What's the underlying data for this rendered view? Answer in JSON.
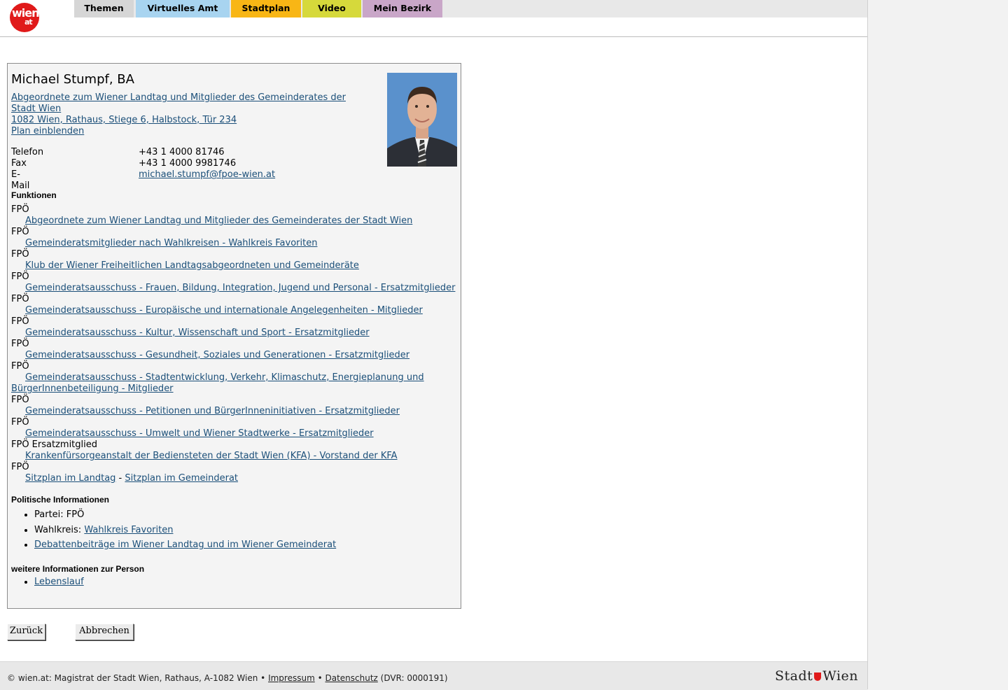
{
  "header": {
    "logo": {
      "line1": "wien",
      "line2": "at"
    },
    "tabs": [
      {
        "label": "Themen",
        "color": "#d6d6d6"
      },
      {
        "label": "Virtuelles Amt",
        "color": "#a8d4f0"
      },
      {
        "label": "Stadtplan",
        "color": "#f8b615"
      },
      {
        "label": "Video",
        "color": "#d6d93b"
      },
      {
        "label": "Mein Bezirk",
        "color": "#c9a6c8"
      }
    ]
  },
  "person": {
    "name": "Michael Stumpf, BA",
    "role_line1": "Abgeordnete zum Wiener Landtag und Mitglieder des Gemeinderates der",
    "role_line2": "Stadt Wien",
    "address": "1082 Wien, Rathaus, Stiege 6, Halbstock, Tür 234",
    "map_link": "Plan einblenden",
    "contact": {
      "phone_label": "Telefon",
      "phone": "+43 1 4000 81746",
      "fax_label": "Fax",
      "fax": "+43 1 4000 9981746",
      "email_label": "E-Mail",
      "email": "michael.stumpf@fpoe-wien.at"
    }
  },
  "functions": {
    "heading": "Funktionen",
    "items": [
      {
        "org": "FPÖ",
        "link": "Abgeordnete zum Wiener Landtag und Mitglieder des Gemeinderates der Stadt Wien"
      },
      {
        "org": "FPÖ",
        "link": "Gemeinderatsmitglieder nach Wahlkreisen - Wahlkreis Favoriten"
      },
      {
        "org": "FPÖ",
        "link": "Klub der Wiener Freiheitlichen Landtagsabgeordneten und Gemeinderäte"
      },
      {
        "org": "FPÖ",
        "link": "Gemeinderatsausschuss - Frauen, Bildung, Integration, Jugend und Personal - Ersatzmitglieder"
      },
      {
        "org": "FPÖ",
        "link": "Gemeinderatsausschuss - Europäische und internationale Angelegenheiten - Mitglieder"
      },
      {
        "org": "FPÖ",
        "link": "Gemeinderatsausschuss - Kultur, Wissenschaft und Sport - Ersatzmitglieder"
      },
      {
        "org": "FPÖ",
        "link": "Gemeinderatsausschuss - Gesundheit, Soziales und Generationen - Ersatzmitglieder"
      },
      {
        "org": "FPÖ",
        "link": "Gemeinderatsausschuss - Stadtentwicklung, Verkehr, Klimaschutz, Energieplanung und BürgerInnenbeteiligung - Mitglieder"
      },
      {
        "org": "FPÖ",
        "link": "Gemeinderatsausschuss - Petitionen und BürgerInneninitiativen - Ersatzmitglieder"
      },
      {
        "org": "FPÖ",
        "link": "Gemeinderatsausschuss - Umwelt und Wiener Stadtwerke - Ersatzmitglieder"
      },
      {
        "org": "FPÖ Ersatzmitglied",
        "link": "Krankenfürsorgeanstalt der Bediensteten der Stadt Wien (KFA) - Vorstand der KFA"
      }
    ],
    "seat_org": "FPÖ",
    "seat_landtag": "Sitzplan im Landtag",
    "seat_sep": " - ",
    "seat_gemeinderat": "Sitzplan im Gemeinderat"
  },
  "political": {
    "heading": "Politische Informationen",
    "party_label": "Partei: ",
    "party": "FPÖ",
    "district_label": "Wahlkreis: ",
    "district": "Wahlkreis Favoriten",
    "debates": "Debattenbeiträge im Wiener Landtag und im Wiener Gemeinderat"
  },
  "more": {
    "heading": "weitere Informationen zur Person",
    "cv": "Lebenslauf"
  },
  "buttons": {
    "back": "Zurück",
    "cancel": "Abbrechen"
  },
  "footer": {
    "copyright": "© wien.at: Magistrat der Stadt Wien, Rathaus, A-1082 Wien • ",
    "imprint": "Impressum",
    "sep": " • ",
    "privacy": "Datenschutz",
    "dvr": " (DVR: 0000191)",
    "brand_left": "Stadt",
    "brand_right": "Wien"
  }
}
